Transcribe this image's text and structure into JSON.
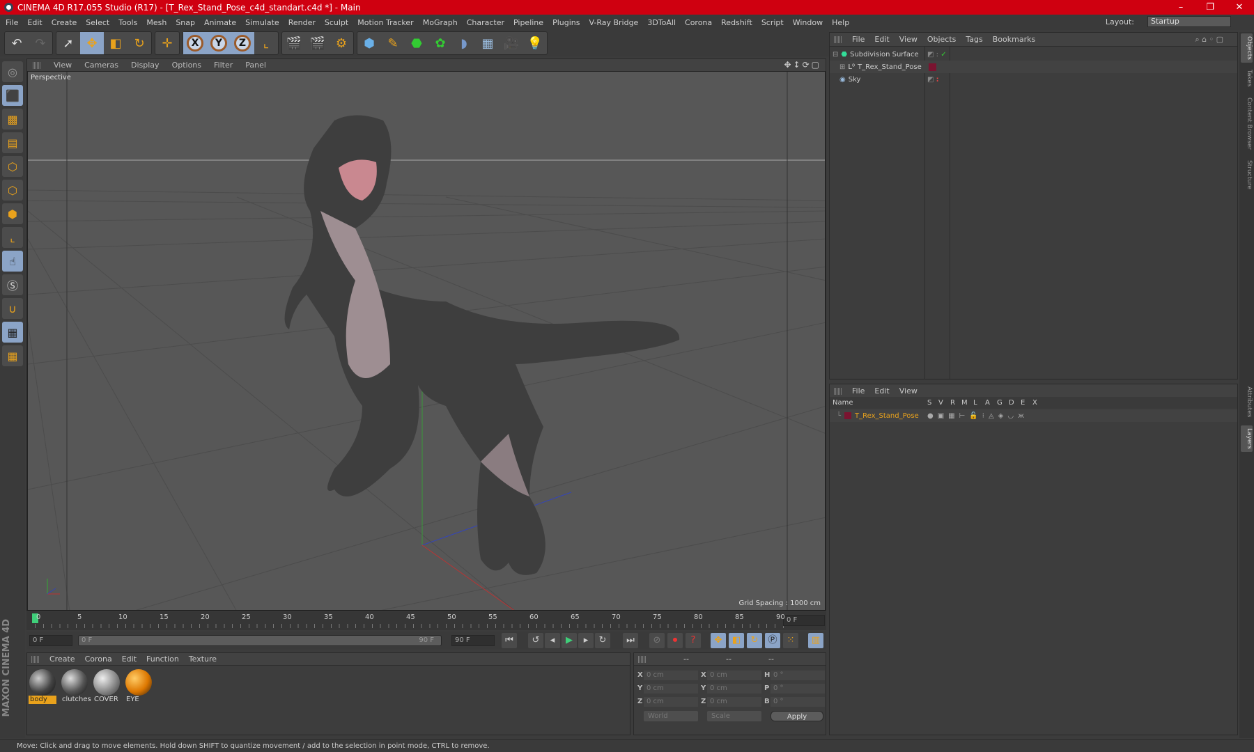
{
  "window": {
    "title": "CINEMA 4D R17.055 Studio (R17) - [T_Rex_Stand_Pose_c4d_standart.c4d *] - Main",
    "controls": [
      "–",
      "❐",
      "✕"
    ]
  },
  "menu": [
    "File",
    "Edit",
    "Create",
    "Select",
    "Tools",
    "Mesh",
    "Snap",
    "Animate",
    "Simulate",
    "Render",
    "Sculpt",
    "Motion Tracker",
    "MoGraph",
    "Character",
    "Pipeline",
    "Plugins",
    "V-Ray Bridge",
    "3DToAll",
    "Corona",
    "Redshift",
    "Script",
    "Window",
    "Help"
  ],
  "layout": {
    "label": "Layout:",
    "value": "Startup"
  },
  "toolbar": {
    "axes": [
      "X",
      "Y",
      "Z"
    ]
  },
  "viewport": {
    "menu": [
      "View",
      "Cameras",
      "Display",
      "Options",
      "Filter",
      "Panel"
    ],
    "camera": "Perspective",
    "grid_spacing": "Grid Spacing : 1000 cm"
  },
  "timeline": {
    "ticks": [
      "0",
      "5",
      "10",
      "15",
      "20",
      "25",
      "30",
      "35",
      "40",
      "45",
      "50",
      "55",
      "60",
      "65",
      "70",
      "75",
      "80",
      "85",
      "90"
    ],
    "current": "0 F",
    "start": "0 F",
    "range_start": "0 F",
    "range_end": "90 F",
    "end": "90 F",
    "progress": 0
  },
  "materials": {
    "menu": [
      "Create",
      "Corona",
      "Edit",
      "Function",
      "Texture"
    ],
    "items": [
      "body",
      "clutches",
      "COVER",
      "EYE"
    ]
  },
  "coordinates": {
    "headers": [
      "--",
      "--",
      "--"
    ],
    "rows": [
      [
        "X",
        "0 cm",
        "X",
        "0 cm",
        "H",
        "0 °"
      ],
      [
        "Y",
        "0 cm",
        "Y",
        "0 cm",
        "P",
        "0 °"
      ],
      [
        "Z",
        "0 cm",
        "Z",
        "0 cm",
        "B",
        "0 °"
      ]
    ],
    "mode": "World",
    "transform": "Scale",
    "apply": "Apply"
  },
  "objects": {
    "menu": [
      "File",
      "Edit",
      "View",
      "Objects",
      "Tags",
      "Bookmarks"
    ],
    "items": [
      "Subdivision Surface",
      "T_Rex_Stand_Pose",
      "Sky"
    ]
  },
  "layers": {
    "menu": [
      "File",
      "Edit",
      "View"
    ],
    "columns": [
      "Name",
      "S",
      "V",
      "R",
      "M",
      "L",
      "A",
      "G",
      "D",
      "E",
      "X"
    ],
    "items": [
      "T_Rex_Stand_Pose"
    ]
  },
  "right_tabs": [
    "Objects",
    "Takes",
    "Content Browser",
    "Structure",
    "Attributes",
    "Layers"
  ],
  "status": "Move: Click and drag to move elements. Hold down SHIFT to quantize movement / add to the selection in point mode, CTRL to remove.",
  "colors": {
    "title_bar": "#cf0010",
    "accent": "#8ba4c7",
    "layer": "#7a1430"
  }
}
